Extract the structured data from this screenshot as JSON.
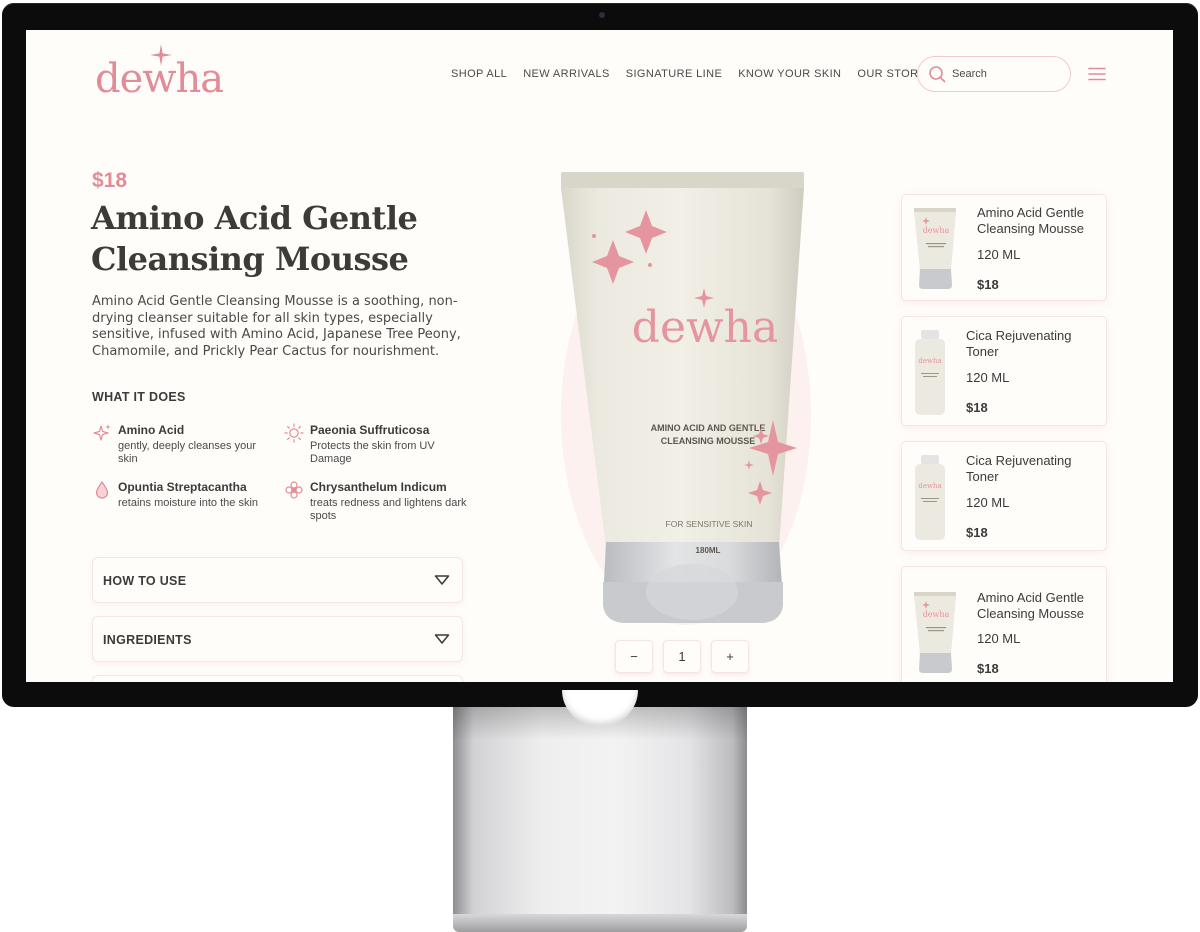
{
  "brand": {
    "name": "dewha",
    "accent_color": "#e38b97"
  },
  "nav": {
    "items": [
      "SHOP ALL",
      "NEW ARRIVALS",
      "SIGNATURE LINE",
      "KNOW YOUR SKIN",
      "OUR STORY"
    ]
  },
  "search": {
    "placeholder": "Search"
  },
  "product": {
    "price": "$18",
    "title": "Amino Acid Gentle Cleansing Mousse",
    "description": "Amino Acid Gentle Cleansing Mousse is a soothing, non-drying cleanser suitable for all skin types, especially sensitive, infused with Amino Acid, Japanese Tree Peony, Chamomile, and Prickly Pear Cactus for nourishment.",
    "what_it_does_heading": "WHAT IT DOES",
    "ingredients": [
      {
        "name": "Amino Acid",
        "description": "gently, deeply cleanses your skin",
        "icon": "sparkle-icon"
      },
      {
        "name": "Paeonia Suffruticosa",
        "description": "Protects the skin from UV Damage",
        "icon": "sun-icon"
      },
      {
        "name": "Opuntia Streptacantha",
        "description": "retains moisture into the skin",
        "icon": "droplet-icon"
      },
      {
        "name": "Chrysanthelum Indicum",
        "description": "treats redness and lightens dark spots",
        "icon": "flower-icon"
      }
    ],
    "accordions": [
      "HOW TO USE",
      "INGREDIENTS"
    ],
    "tube": {
      "brand": "dewha",
      "label_line1": "AMINO ACID AND GENTLE",
      "label_line2": "CLEANSING MOUSSE",
      "tagline": "FOR SENSITIVE SKIN",
      "volume": "180ML"
    },
    "quantity": {
      "minus": "−",
      "value": "1",
      "plus": "+"
    }
  },
  "related": [
    {
      "title": "Amino Acid Gentle Cleansing Mousse",
      "size": "120 ML",
      "price": "$18",
      "kind": "tube"
    },
    {
      "title": "Cica Rejuvenating Toner",
      "size": "120 ML",
      "price": "$18",
      "kind": "bottle"
    },
    {
      "title": "Cica Rejuvenating Toner",
      "size": "120 ML",
      "price": "$18",
      "kind": "bottle"
    },
    {
      "title": "Amino Acid Gentle Cleansing Mousse",
      "size": "120 ML",
      "price": "$18",
      "kind": "tube"
    }
  ]
}
